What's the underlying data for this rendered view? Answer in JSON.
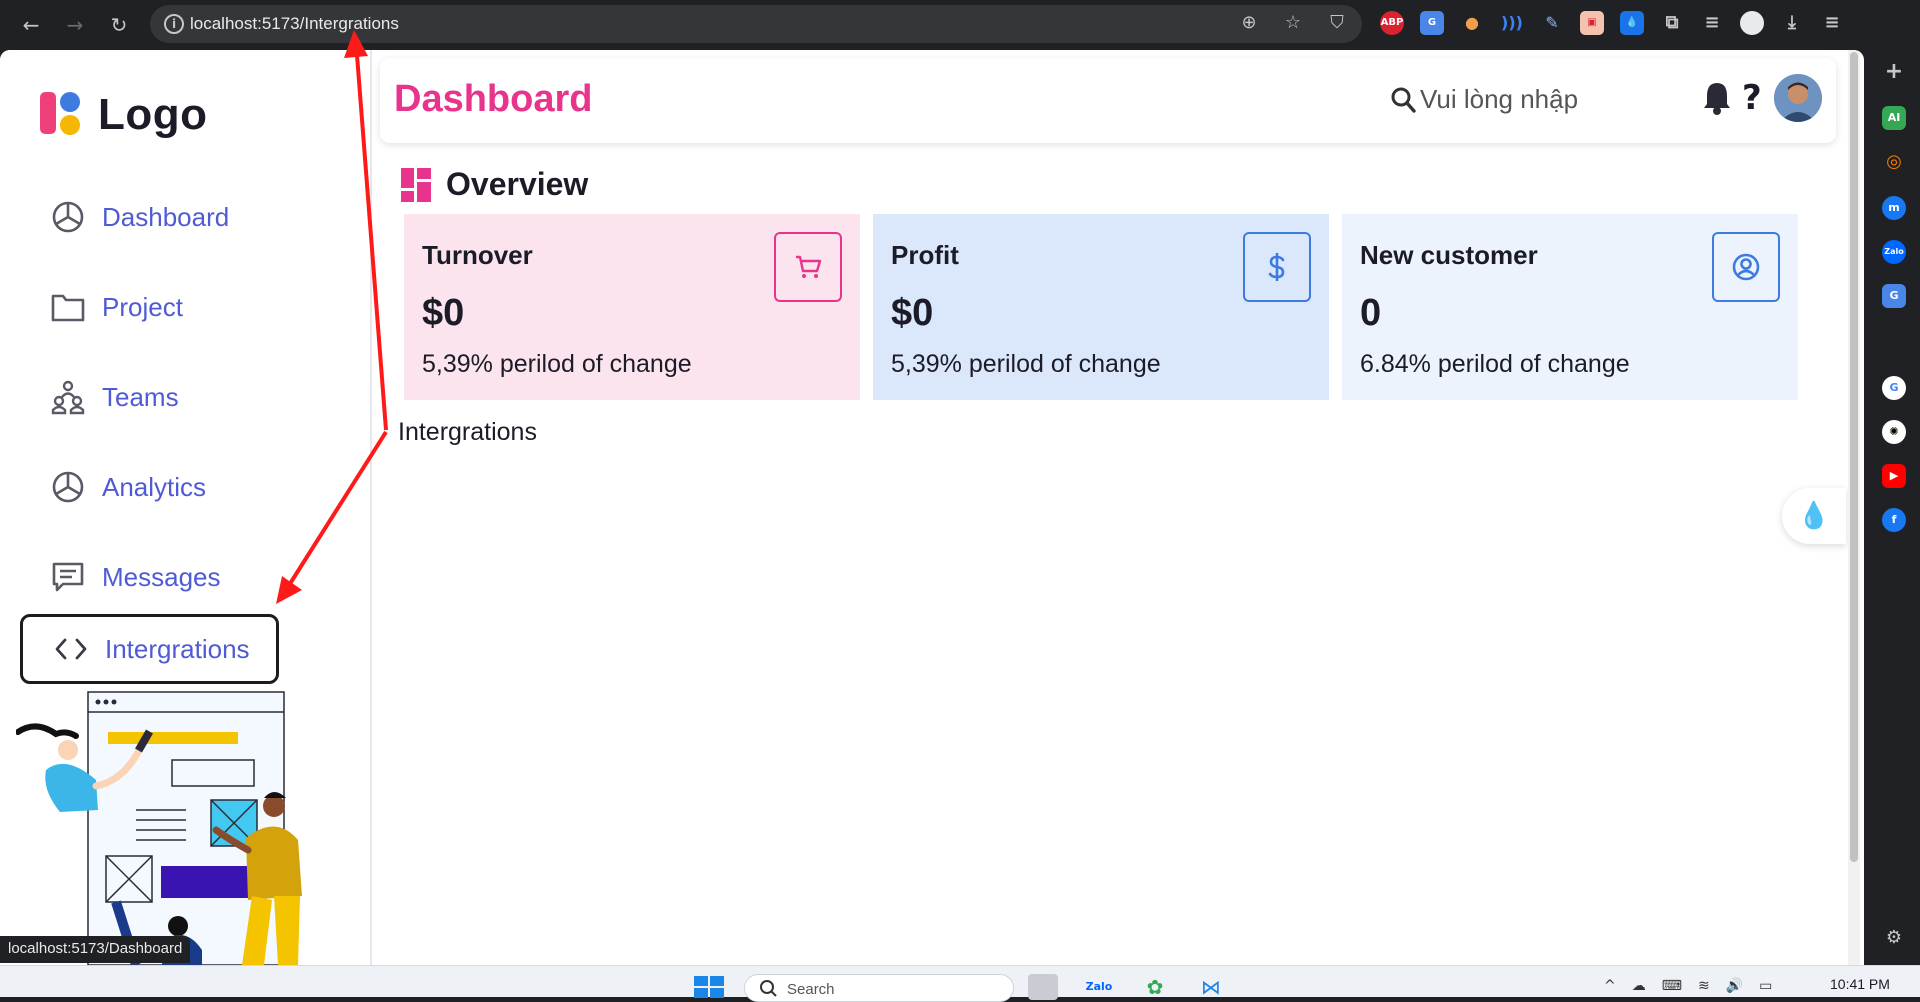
{
  "browser": {
    "url": "localhost:5173/Intergrations",
    "back_icon": "arrow-left-icon",
    "forward_icon": "arrow-right-icon",
    "reload_icon": "reload-icon",
    "status_url": "localhost:5173/Dashboard",
    "ext_abp": "ABP"
  },
  "sidebar": {
    "logo": "Logo",
    "items": [
      {
        "label": "Dashboard",
        "icon": "pie-chart-icon"
      },
      {
        "label": "Project",
        "icon": "folder-icon"
      },
      {
        "label": "Teams",
        "icon": "team-icon"
      },
      {
        "label": "Analytics",
        "icon": "pie-chart-icon"
      },
      {
        "label": "Messages",
        "icon": "message-icon"
      },
      {
        "label": "Intergrations",
        "icon": "code-icon",
        "active": true
      }
    ]
  },
  "header": {
    "title": "Dashboard",
    "search_placeholder": "Vui lòng nhập",
    "help": "?"
  },
  "overview": {
    "title": "Overview",
    "cards": [
      {
        "title": "Turnover",
        "value": "$0",
        "change": "5,39% perilod of change",
        "icon": "cart-icon",
        "bg": "#fce4ef",
        "accent": "#e8348d"
      },
      {
        "title": "Profit",
        "value": "$0",
        "change": "5,39% perilod of change",
        "icon": "dollar-icon",
        "bg": "#dbe7fb",
        "accent": "#3d7be0"
      },
      {
        "title": "New customer",
        "value": "0",
        "change": "6.84% perilod of change",
        "icon": "user-circle-icon",
        "bg": "#edf3fd",
        "accent": "#3d7be0"
      }
    ]
  },
  "content": {
    "text": "Intergrations"
  },
  "colors": {
    "title_pink": "#e8348d",
    "nav_blue": "#4f5bd5",
    "annotation_red": "#ff1a1a"
  },
  "taskbar": {
    "search": "Search",
    "time": "10:41 PM",
    "zalo": "Zalo"
  }
}
